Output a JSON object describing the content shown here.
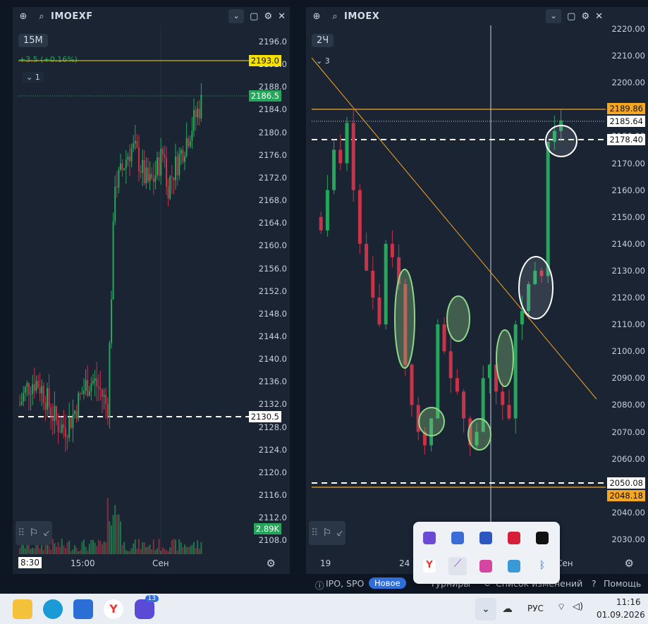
{
  "left_panel": {
    "ticker": "IMOEXF",
    "timeframe": "15M",
    "change": "+3.5 (+0.16%)",
    "indicator_count": "1",
    "y_ticks": [
      "2196.0",
      "2192.0",
      "2188.0",
      "2184.0",
      "2180.0",
      "2176.0",
      "2172.0",
      "2168.0",
      "2164.0",
      "2160.0",
      "2156.0",
      "2152.0",
      "2148.0",
      "2144.0",
      "2140.0",
      "2136.0",
      "2132.0",
      "2128.0",
      "2124.0",
      "2120.0",
      "2116.0",
      "2112.0",
      "2108.0"
    ],
    "price_high_tag": "2193.0",
    "price_last_tag": "2186.5",
    "price_level_tag": "2130.5",
    "volume_tag": "2.89K",
    "x_labels": [
      "8:30",
      "15:00",
      "Сен"
    ]
  },
  "right_panel": {
    "ticker": "IMOEX",
    "timeframe": "2Ч",
    "indicator_count": "3",
    "y_ticks": [
      "2220.00",
      "2210.00",
      "2200.00",
      "2190.00",
      "2180.00",
      "2170.00",
      "2160.00",
      "2150.00",
      "2140.00",
      "2130.00",
      "2120.00",
      "2110.00",
      "2100.00",
      "2090.00",
      "2080.00",
      "2070.00",
      "2060.00",
      "2050.00",
      "2040.00",
      "2030.00"
    ],
    "tag_orange_top": "2189.86",
    "tag_last": "2185.64",
    "tag_dashed": "2178.40",
    "tag_dashed_low": "2050.08",
    "tag_orange_low": "2048.18",
    "x_labels": [
      "19",
      "24",
      "Сен"
    ]
  },
  "statusbar": {
    "ipo": "IPO, SPO",
    "new_badge": "Новое",
    "tournaments": "Турниры",
    "changes": "Список изменений",
    "help": "Помощь"
  },
  "taskbar": {
    "notification_count": "13",
    "lang": "РУС",
    "time": "11:16",
    "date": "01.09.2026"
  },
  "colors": {
    "up": "#26a65b",
    "down": "#c8334a",
    "accent": "#f5a623",
    "bg": "#1a2433"
  }
}
